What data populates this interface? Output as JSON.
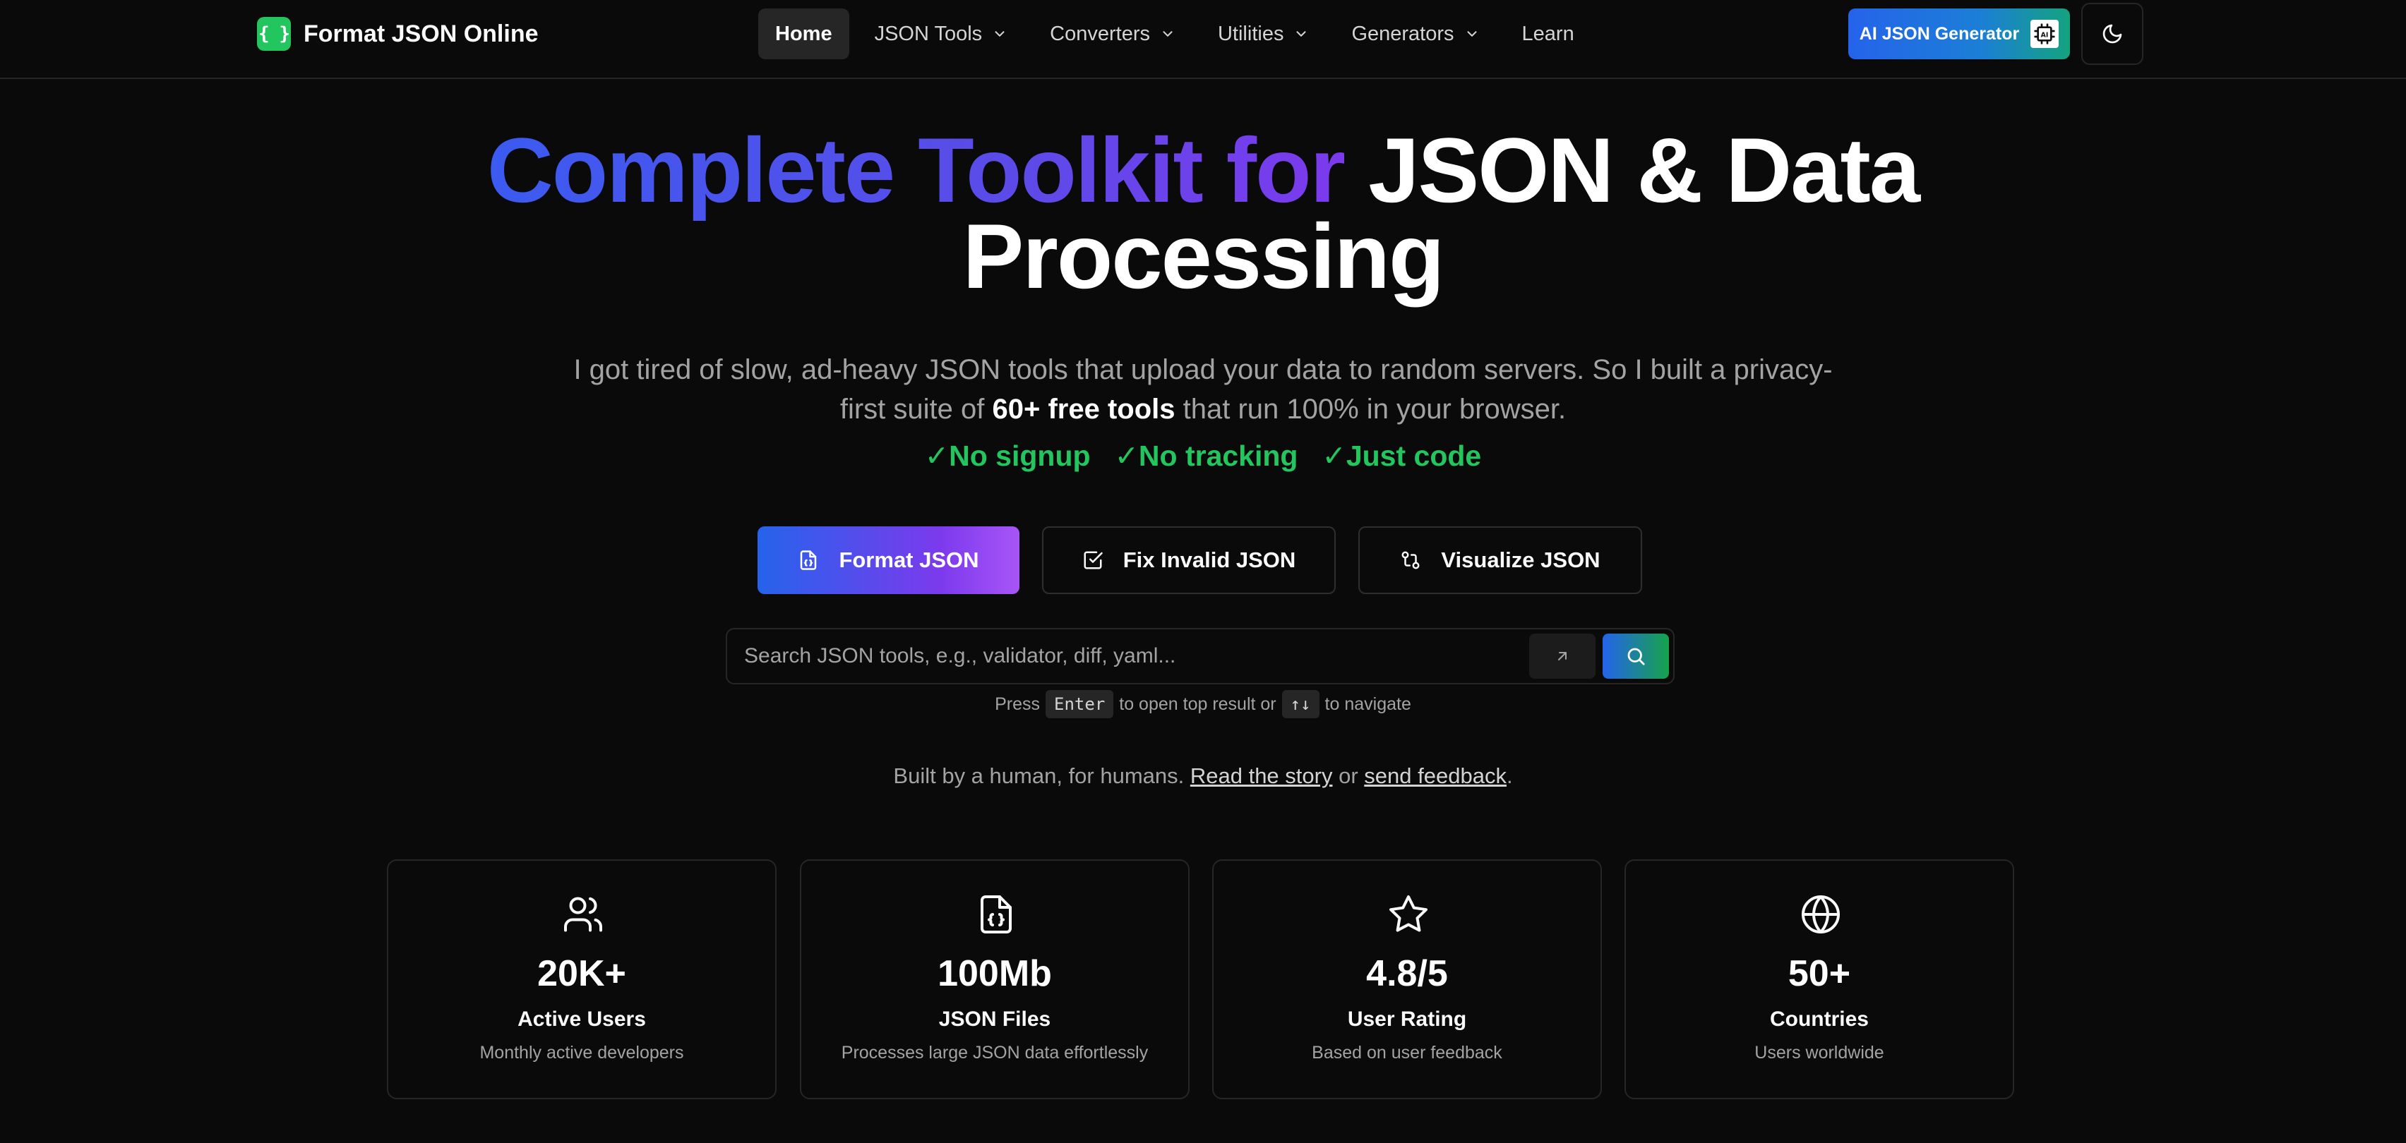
{
  "header": {
    "brand": {
      "logo_text": "{ }",
      "name": "Format JSON Online"
    },
    "nav": [
      {
        "label": "Home",
        "active": true,
        "dropdown": false
      },
      {
        "label": "JSON Tools",
        "active": false,
        "dropdown": true
      },
      {
        "label": "Converters",
        "active": false,
        "dropdown": true
      },
      {
        "label": "Utilities",
        "active": false,
        "dropdown": true
      },
      {
        "label": "Generators",
        "active": false,
        "dropdown": true
      },
      {
        "label": "Learn",
        "active": false,
        "dropdown": false
      }
    ],
    "ai_button": {
      "label": "AI JSON Generator",
      "icon": "ai-chip-icon"
    },
    "theme_toggle": {
      "icon": "moon-icon"
    }
  },
  "hero": {
    "title_gradient": "Complete Toolkit for",
    "title_white_1": "JSON & Data",
    "title_white_2": "Processing",
    "subtitle_pre": "I got tired of slow, ad-heavy JSON tools that upload your data to random servers. So I built a privacy-first suite of",
    "subtitle_bold": "60+ free tools",
    "subtitle_post": "that run 100% in your browser.",
    "perks": [
      "✓No signup",
      "✓No tracking",
      "✓Just code"
    ]
  },
  "cta": {
    "format": {
      "label": "Format JSON",
      "icon": "file-json-icon"
    },
    "fix": {
      "label": "Fix Invalid JSON",
      "icon": "check-square-icon"
    },
    "visualize": {
      "label": "Visualize JSON",
      "icon": "git-compare-icon"
    }
  },
  "search": {
    "placeholder": "Search JSON tools, e.g., validator, diff, yaml...",
    "value": "",
    "hint_press": "Press",
    "hint_key_enter": "Enter",
    "hint_mid": "to open top result or",
    "hint_key_arrows": "↑↓",
    "hint_end": "to navigate"
  },
  "built": {
    "text": "Built by a human, for humans.",
    "story_link": "Read the story",
    "or": "or",
    "feedback_link": "send feedback",
    "period": "."
  },
  "stats": [
    {
      "icon": "users-icon",
      "value": "20K+",
      "label": "Active Users",
      "desc": "Monthly active developers"
    },
    {
      "icon": "file-json-icon",
      "value": "100Mb",
      "label": "JSON Files",
      "desc": "Processes large JSON data effortlessly"
    },
    {
      "icon": "star-icon",
      "value": "4.8/5",
      "label": "User Rating",
      "desc": "Based on user feedback"
    },
    {
      "icon": "globe-icon",
      "value": "50+",
      "label": "Countries",
      "desc": "Users worldwide"
    }
  ],
  "colors": {
    "background": "#0a0a0a",
    "accent_green": "#22c55e",
    "accent_blue": "#2563eb",
    "accent_purple": "#7c3aed",
    "border": "#262626"
  }
}
